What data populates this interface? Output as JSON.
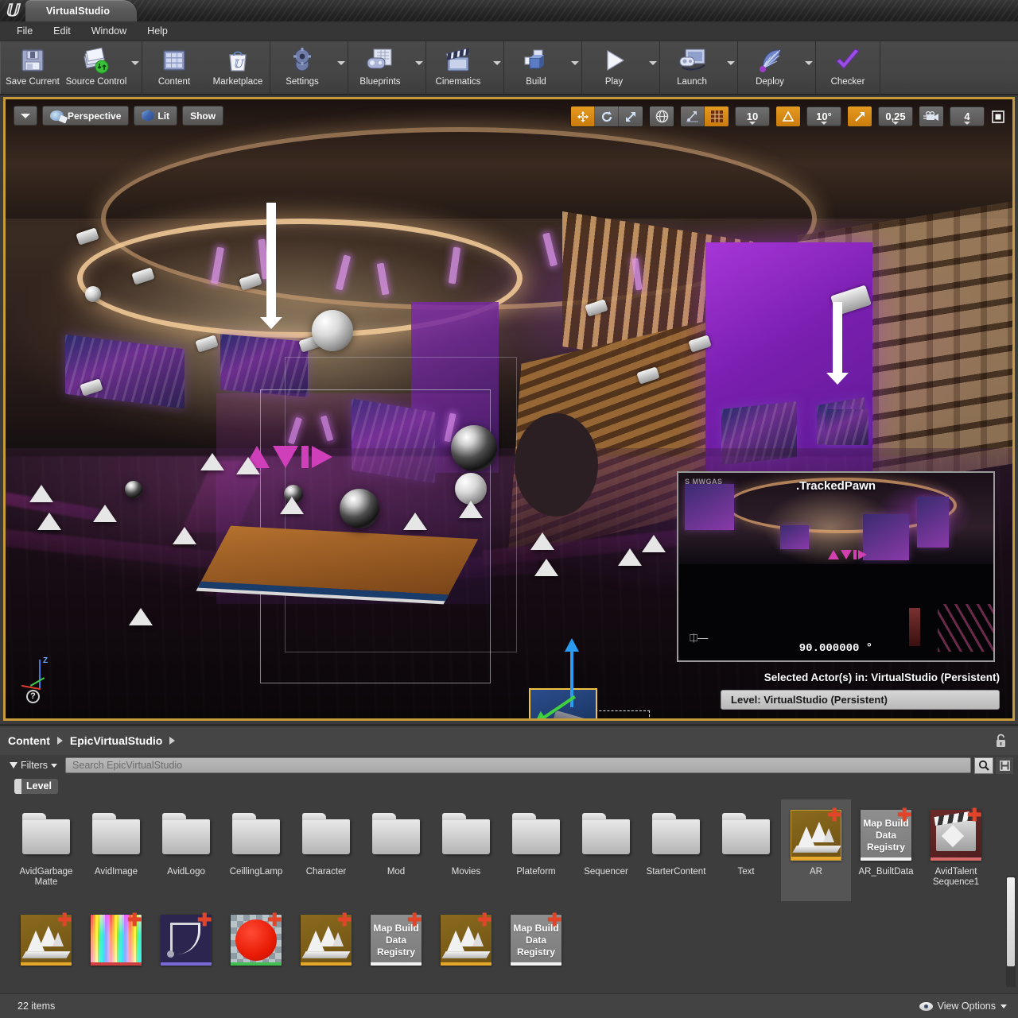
{
  "window": {
    "app_icon": "unreal-logo-icon",
    "tab_title": "VirtualStudio"
  },
  "menubar": {
    "items": [
      {
        "label": "File"
      },
      {
        "label": "Edit"
      },
      {
        "label": "Window"
      },
      {
        "label": "Help"
      }
    ]
  },
  "toolbar": {
    "groups": [
      {
        "buttons": [
          {
            "label": "Save Current",
            "icon": "floppy-disk-icon",
            "has_dropdown": false
          },
          {
            "label": "Source Control",
            "icon": "source-control-icon",
            "has_dropdown": true
          }
        ]
      },
      {
        "buttons": [
          {
            "label": "Content",
            "icon": "content-grid-icon",
            "has_dropdown": false
          },
          {
            "label": "Marketplace",
            "icon": "shopping-bag-icon",
            "has_dropdown": false
          }
        ]
      },
      {
        "buttons": [
          {
            "label": "Settings",
            "icon": "gear-icon",
            "has_dropdown": true
          }
        ]
      },
      {
        "buttons": [
          {
            "label": "Blueprints",
            "icon": "blueprint-gamepad-icon",
            "has_dropdown": true
          }
        ]
      },
      {
        "buttons": [
          {
            "label": "Cinematics",
            "icon": "clapperboard-icon",
            "has_dropdown": true
          }
        ]
      },
      {
        "buttons": [
          {
            "label": "Build",
            "icon": "build-boxes-icon",
            "has_dropdown": true
          }
        ]
      },
      {
        "buttons": [
          {
            "label": "Play",
            "icon": "play-triangle-icon",
            "has_dropdown": true
          }
        ]
      },
      {
        "buttons": [
          {
            "label": "Launch",
            "icon": "launch-device-icon",
            "has_dropdown": true
          }
        ]
      },
      {
        "buttons": [
          {
            "label": "Deploy",
            "icon": "deploy-fan-icon",
            "has_dropdown": true
          }
        ]
      },
      {
        "buttons": [
          {
            "label": "Checker",
            "icon": "purple-checkmark-icon",
            "has_dropdown": false
          }
        ]
      }
    ]
  },
  "viewport": {
    "left_toolbar": {
      "menu_arrow_icon": "chevron-down-icon",
      "view_mode_label": "Perspective",
      "view_mode_icon": "perspective-camera-icon",
      "lighting_label": "Lit",
      "lighting_icon": "lit-cube-icon",
      "show_label": "Show"
    },
    "right_toolbar": {
      "transform_tools": [
        {
          "name": "translate-mode",
          "icon": "move-arrows-icon",
          "active": true
        },
        {
          "name": "rotate-mode",
          "icon": "rotate-icon",
          "active": false
        },
        {
          "name": "scale-mode",
          "icon": "scale-arrow-icon",
          "active": false
        }
      ],
      "coordinate_system": {
        "name": "world-space-toggle",
        "icon": "globe-icon",
        "active": false
      },
      "surface_snap": {
        "name": "surface-snap-toggle",
        "icon": "surface-snap-icon",
        "active": false
      },
      "grid_snap_toggle": {
        "name": "grid-snap-toggle",
        "icon": "grid-icon",
        "active": true
      },
      "grid_snap_value": "10",
      "rotation_snap_toggle": {
        "name": "rotation-snap-toggle",
        "icon": "angle-icon",
        "active": true
      },
      "rotation_snap_value": "10°",
      "scale_snap_toggle": {
        "name": "scale-snap-toggle",
        "icon": "diagonal-arrow-icon",
        "active": true
      },
      "scale_snap_value": "0,25",
      "camera_speed_icon": "camera-speed-icon",
      "camera_speed_value": "4",
      "maximize_icon": "maximize-viewport-icon"
    },
    "pip": {
      "actor_label": ".TrackedPawn",
      "fov_value": "90.000000 °",
      "pin_icon": "pin-icon",
      "side_text": "S MWGAS"
    },
    "selected_actor_text": "Selected Actor(s) in:  VirtualStudio (Persistent)",
    "level_text": "Level:  VirtualStudio (Persistent)",
    "axis_gizmo": {
      "z_label": "Z",
      "help_label": "?"
    },
    "scene": {
      "avid_logo": "avid-logo",
      "selected_actor_name": "TrackedPawn camera actor",
      "gizmo_axes": [
        "x-red",
        "y-green",
        "z-blue"
      ]
    }
  },
  "content_browser": {
    "breadcrumb": [
      {
        "label": "Content"
      },
      {
        "label": "EpicVirtualStudio"
      }
    ],
    "lock_icon": "unlock-icon",
    "filters_label": "Filters",
    "filters_icon": "funnel-icon",
    "search": {
      "placeholder": "Search EpicVirtualStudio",
      "value": "",
      "search_icon": "magnifier-icon",
      "save_search_icon": "save-icon"
    },
    "active_filters": [
      {
        "label": "Level",
        "color": "#d6d6d6"
      }
    ],
    "rows": [
      [
        {
          "name": "AvidGarbage\nMatte",
          "type": "folder",
          "selected": false
        },
        {
          "name": "AvidImage",
          "type": "folder",
          "selected": false
        },
        {
          "name": "AvidLogo",
          "type": "folder",
          "selected": false
        },
        {
          "name": "CeillingLamp",
          "type": "folder",
          "selected": false
        },
        {
          "name": "Character",
          "type": "folder",
          "selected": false
        },
        {
          "name": "Mod",
          "type": "folder",
          "selected": false
        },
        {
          "name": "Movies",
          "type": "folder",
          "selected": false
        },
        {
          "name": "Plateform",
          "type": "folder",
          "selected": false
        },
        {
          "name": "Sequencer",
          "type": "folder",
          "selected": false
        },
        {
          "name": "StarterContent",
          "type": "folder",
          "selected": false
        },
        {
          "name": "Text",
          "type": "folder",
          "selected": false
        },
        {
          "name": "AR",
          "type": "level",
          "selected": true,
          "badge": "plus-icon"
        },
        {
          "name": "AR_BuiltData",
          "type": "map-build-data-registry",
          "thumb_text": "Map Build Data Registry",
          "selected": false,
          "badge": "plus-icon"
        },
        {
          "name": "AvidTalent\nSequence1",
          "type": "level-sequence",
          "selected": false,
          "badge": "plus-icon"
        }
      ],
      [
        {
          "name": "",
          "type": "level",
          "selected": false,
          "badge": "plus-icon"
        },
        {
          "name": "",
          "type": "texture-gradient",
          "selected": false,
          "badge": "plus-icon"
        },
        {
          "name": "",
          "type": "curve",
          "selected": false,
          "badge": "plus-icon"
        },
        {
          "name": "",
          "type": "material-red",
          "selected": false,
          "badge": "plus-icon"
        },
        {
          "name": "",
          "type": "level",
          "selected": false,
          "badge": "plus-icon"
        },
        {
          "name": "",
          "type": "map-build-data-registry",
          "thumb_text": "Map Build Data Registry",
          "selected": false,
          "badge": "plus-icon"
        },
        {
          "name": "",
          "type": "level",
          "selected": false,
          "badge": "plus-icon"
        },
        {
          "name": "",
          "type": "map-build-data-registry",
          "thumb_text": "Map Build Data Registry",
          "selected": false,
          "badge": "plus-icon"
        }
      ]
    ],
    "status": {
      "item_count": "22 items",
      "view_options_label": "View Options",
      "view_options_icon": "eye-icon",
      "view_options_caret": "chevron-down-icon"
    }
  },
  "colors": {
    "accent_orange": "#e59a20",
    "viewport_border": "#c79a3a",
    "panel_bg": "#3d3d3d",
    "toolbar_bg": "#444444",
    "avid_magenta": "#cf3fba",
    "badge_red": "#e0452a"
  }
}
